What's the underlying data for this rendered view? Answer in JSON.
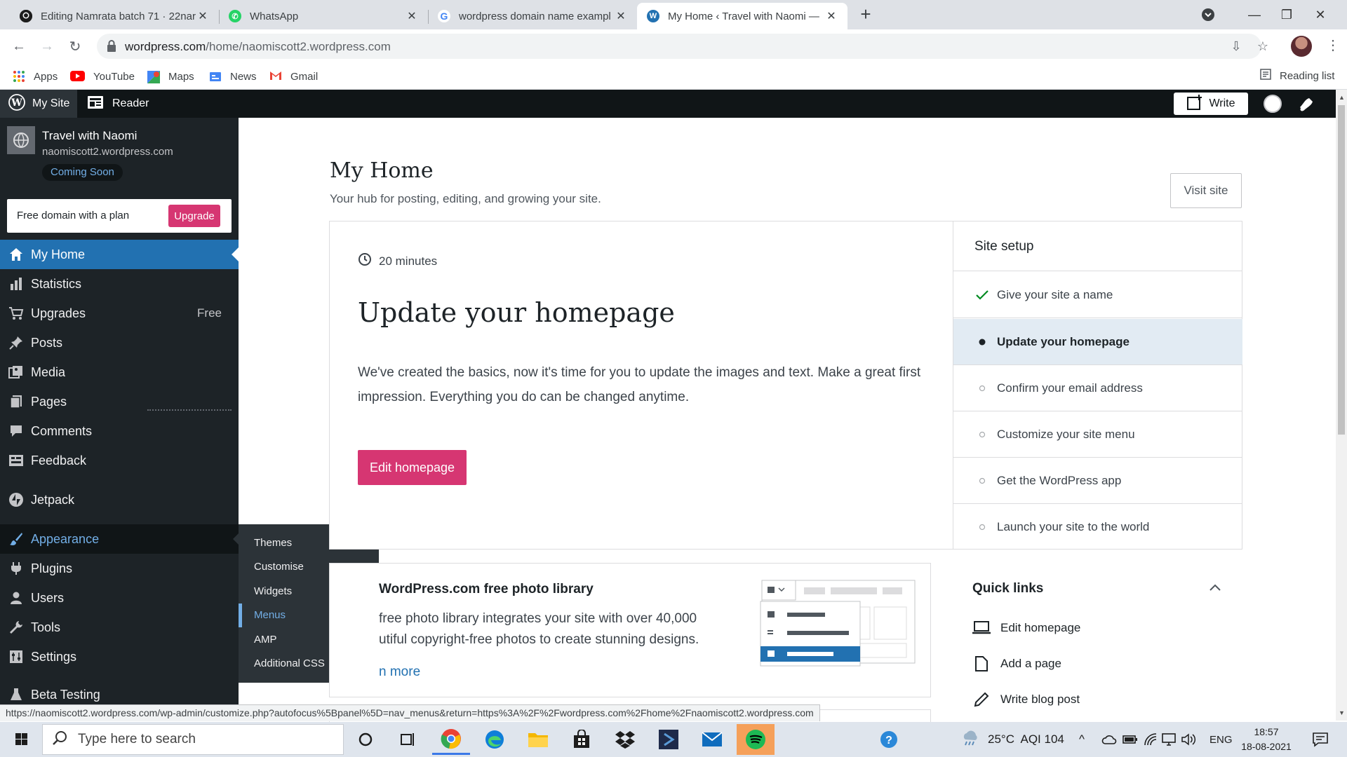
{
  "browser": {
    "tabs": [
      {
        "title": "Editing Namrata batch 71 · 22nar",
        "icon": "github-icon"
      },
      {
        "title": "WhatsApp",
        "icon": "whatsapp-icon"
      },
      {
        "title": "wordpress domain name exampl",
        "icon": "google-icon"
      },
      {
        "title": "My Home ‹ Travel with Naomi —",
        "icon": "wordpress-icon"
      }
    ],
    "url_domain": "wordpress.com",
    "url_path": "/home/naomiscott2.wordpress.com",
    "bookmarks": [
      "Apps",
      "YouTube",
      "Maps",
      "News",
      "Gmail"
    ],
    "reading_list": "Reading list"
  },
  "masterbar": {
    "my_site": "My Site",
    "reader": "Reader",
    "write": "Write"
  },
  "sidebar": {
    "site_title": "Travel with Naomi",
    "site_url": "naomiscott2.wordpress.com",
    "site_status": "Coming Soon",
    "upsell_text": "Free domain with a plan",
    "upsell_button": "Upgrade",
    "items": [
      {
        "label": "My Home"
      },
      {
        "label": "Statistics"
      },
      {
        "label": "Upgrades",
        "badge": "Free"
      },
      {
        "label": "Posts"
      },
      {
        "label": "Media"
      },
      {
        "label": "Pages"
      },
      {
        "label": "Comments"
      },
      {
        "label": "Feedback"
      },
      {
        "label": "Jetpack"
      },
      {
        "label": "Appearance"
      },
      {
        "label": "Plugins"
      },
      {
        "label": "Users"
      },
      {
        "label": "Tools"
      },
      {
        "label": "Settings"
      },
      {
        "label": "Beta Testing"
      }
    ],
    "flyout": [
      "Themes",
      "Customise",
      "Widgets",
      "Menus",
      "AMP",
      "Additional CSS"
    ]
  },
  "main": {
    "title": "My Home",
    "subtitle": "Your hub for posting, editing, and growing your site.",
    "visit_site": "Visit site",
    "task": {
      "time": "20 minutes",
      "title": "Update your homepage",
      "description": "We've created the basics, now it's time for you to update the images and text. Make a great first impression. Everything you do can be changed anytime.",
      "button": "Edit homepage"
    },
    "setup": {
      "title": "Site setup",
      "items": [
        {
          "label": "Give your site a name",
          "state": "done"
        },
        {
          "label": "Update your homepage",
          "state": "current"
        },
        {
          "label": "Confirm your email address",
          "state": "todo"
        },
        {
          "label": "Customize your site menu",
          "state": "todo"
        },
        {
          "label": "Get the WordPress app",
          "state": "todo"
        },
        {
          "label": "Launch your site to the world",
          "state": "todo"
        }
      ]
    },
    "photo": {
      "title": "WordPress.com free photo library",
      "desc1": "free photo library integrates your site with over 40,000",
      "desc2": "utiful copyright-free photos to create stunning designs.",
      "more": "n more"
    },
    "quick_links": {
      "title": "Quick links",
      "items": [
        "Edit homepage",
        "Add a page",
        "Write blog post"
      ]
    }
  },
  "status_url": "https://naomiscott2.wordpress.com/wp-admin/customize.php?autofocus%5Bpanel%5D=nav_menus&return=https%3A%2F%2Fwordpress.com%2Fhome%2Fnaomiscott2.wordpress.com",
  "taskbar": {
    "search_placeholder": "Type here to search",
    "weather": "25°C  AQI 104",
    "language": "ENG",
    "time": "18:57",
    "date": "18-08-2021"
  },
  "colors": {
    "wp_pink": "#d63672",
    "wp_blue": "#2271b1",
    "sidebar_bg": "#1d2327",
    "masterbar_bg": "#101517"
  }
}
